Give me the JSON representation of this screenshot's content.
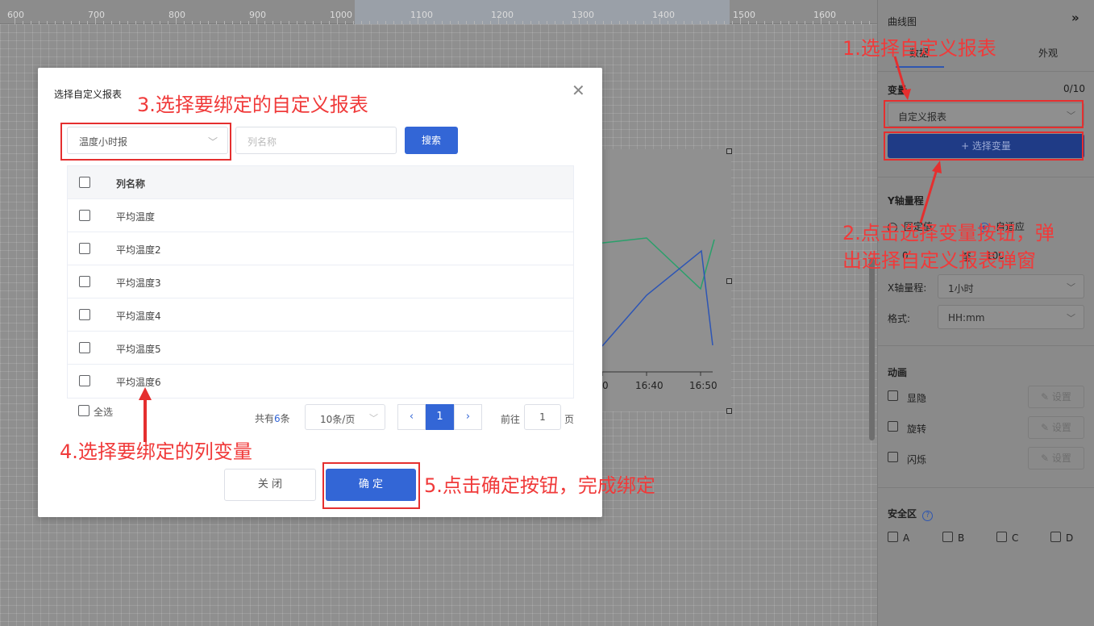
{
  "ruler": {
    "ticks": [
      "600",
      "700",
      "800",
      "900",
      "1000",
      "1100",
      "1200",
      "1300",
      "1400",
      "1500",
      "1600"
    ]
  },
  "chart": {
    "x_labels": [
      "0",
      "16:40",
      "16:50"
    ]
  },
  "panel": {
    "title": "曲线图",
    "collapse_icon": "double-chevron-right",
    "tabs": [
      {
        "label": "数据",
        "active": true
      },
      {
        "label": "外观",
        "active": false
      }
    ],
    "variable": {
      "label": "变量",
      "count": "0/10",
      "source_value": "自定义报表",
      "select_button": "+ 选择变量"
    },
    "y_axis": {
      "label": "Y轴量程",
      "options": [
        "固定值",
        "自适应"
      ],
      "min": "0",
      "to": "至",
      "max": "100"
    },
    "x_axis": {
      "label": "X轴量程:",
      "value": "1小时"
    },
    "format": {
      "label": "格式:",
      "value": "HH:mm"
    },
    "animation": {
      "label": "动画",
      "items": [
        {
          "label": "显隐",
          "button": "设置"
        },
        {
          "label": "旋转",
          "button": "设置"
        },
        {
          "label": "闪烁",
          "button": "设置"
        }
      ]
    },
    "safe_zone": {
      "label": "安全区",
      "options": [
        "A",
        "B",
        "C",
        "D"
      ]
    }
  },
  "modal": {
    "title": "选择自定义报表",
    "report_select_value": "温度小时报",
    "column_placeholder": "列名称",
    "search_button": "搜索",
    "table": {
      "header": "列名称",
      "rows": [
        "平均温度",
        "平均温度2",
        "平均温度3",
        "平均温度4",
        "平均温度5",
        "平均温度6"
      ]
    },
    "select_all": "全选",
    "pagination": {
      "total_prefix": "共有",
      "total": "6",
      "total_suffix": "条",
      "page_size": "10条/页",
      "current_page": "1",
      "goto_label": "前往",
      "goto_value": "1",
      "goto_unit": "页"
    },
    "close_button": "关 闭",
    "confirm_button": "确 定"
  },
  "annotations": {
    "step1": "1.选择自定义报表",
    "step2_line1": "2.点击选择变量按钮，弹",
    "step2_line2": "出选择自定义报表弹窗",
    "step3": "3.选择要绑定的自定义报表",
    "step4": "4.选择要绑定的列变量",
    "step5": "5.点击确定按钮，完成绑定",
    "color": "#f03a3a"
  }
}
